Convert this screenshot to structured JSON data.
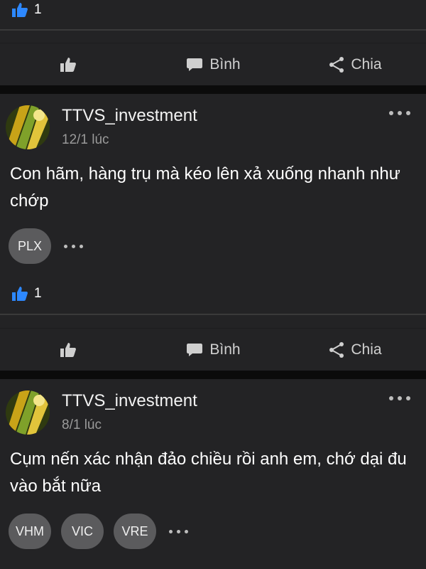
{
  "top_section": {
    "like_count": "1"
  },
  "actions": {
    "like_label": "",
    "comment_label": "Bình",
    "share_label": "Chia"
  },
  "posts": [
    {
      "author": "TTVS_investment",
      "time": "12/1 lúc",
      "text": "Con hãm, hàng trụ mà kéo lên xả xuống nhanh như chớp",
      "tags": [
        "PLX"
      ],
      "like_count": "1"
    },
    {
      "author": "TTVS_investment",
      "time": "8/1 lúc",
      "text": "Cụm nến xác nhận đảo chiều rồi anh em, chớ dại đu vào bắt nữa",
      "tags": [
        "VHM",
        "VIC",
        "VRE"
      ]
    }
  ],
  "colors": {
    "background": "#0f0f0f",
    "card": "#232325",
    "like_blue": "#2d88ff",
    "tag_bg": "#5b5b5d",
    "muted_text": "#9a9a9a"
  },
  "icons": [
    "thumbs-up-icon",
    "comment-icon",
    "share-icon",
    "more-dots-icon",
    "avatar-image"
  ]
}
